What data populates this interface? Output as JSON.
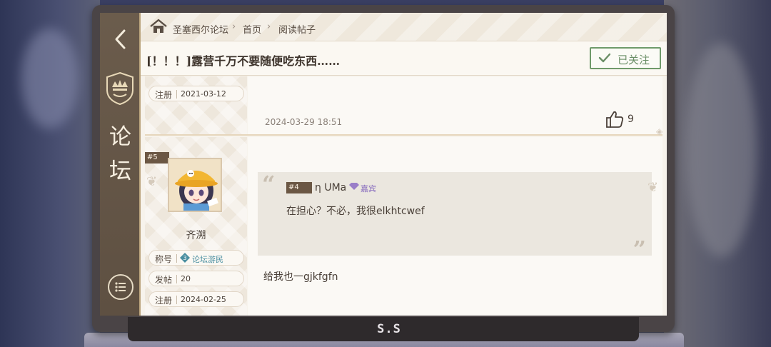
{
  "brand": "S.S",
  "sidebar": {
    "back_icon": "chevron-left-icon",
    "title_line1": "论",
    "title_line2": "坛",
    "menu_icon": "list-icon"
  },
  "breadcrumb": {
    "home_icon": "home-icon",
    "items": [
      "圣塞西尔论坛",
      "首页",
      "阅读帖子"
    ]
  },
  "post": {
    "title": "[！！！]露营千万不要随便吃东西……",
    "follow_label": "已关注"
  },
  "previous_floor": {
    "register_key": "注册",
    "register_date": "2021-03-12",
    "timestamp": "2024-03-29  18:51",
    "like_count": "9"
  },
  "floor": {
    "number": "#5",
    "user": {
      "name": "齐溯",
      "title_key": "称号",
      "title_value": "论坛游民",
      "posts_key": "发帖",
      "posts_value": "20",
      "register_key": "注册",
      "register_date": "2024-02-25"
    },
    "quote": {
      "floor": "#4",
      "author": "η  UMa",
      "badge": "嘉宾",
      "text": "在担心？不必，我很elkhtcwef"
    },
    "reply": "给我也一gjkfgfn"
  },
  "colors": {
    "accent_green": "#6f9a6a",
    "sidebar_brown": "#6b5c4c",
    "badge_purple": "#8a6fbf",
    "title_teal": "#4a8ea0"
  }
}
